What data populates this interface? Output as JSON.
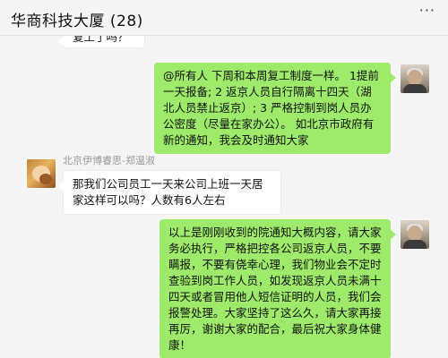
{
  "header": {
    "title": "华商科技大厦 (28)",
    "more_label": "···"
  },
  "messages": [
    {
      "side": "left",
      "text": "复工了吗？"
    },
    {
      "side": "right",
      "text": "@所有人 下周和本周复工制度一样。 1提前一天报备; 2 返京人员自行隔离十四天（湖北人员禁止返京）; 3 严格控制到岗人员办公密度（尽量在家办公）。 如北京市政府有新的通知，我会及时通知大家"
    },
    {
      "side": "left",
      "sender": "北京伊博睿思-郑温淑",
      "text": "那我们公司员工一天来公司上班一天居家这样可以吗？人数有6人左右"
    },
    {
      "side": "right",
      "text": "以上是刚刚收到的院通知大概内容，请大家务必执行，严格把控各公司返京人员，不要瞒报，不要有侥幸心理，我们物业会不定时查验到岗工作人员，如发现返京人员未满十四天或者冒用他人短信证明的人员，我们会报警处理。大家坚持了这么久，请大家再接再厉，谢谢大家的配合，最后祝大家身体健康！"
    }
  ]
}
